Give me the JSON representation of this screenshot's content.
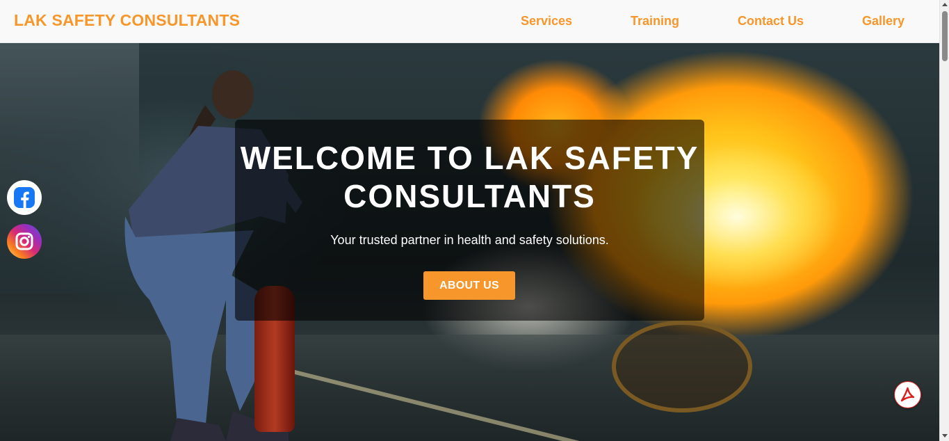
{
  "header": {
    "brand": "LAK SAFETY CONSULTANTS",
    "nav": [
      {
        "label": "Services"
      },
      {
        "label": "Training"
      },
      {
        "label": "Contact Us"
      },
      {
        "label": "Gallery"
      }
    ]
  },
  "hero": {
    "title": "WELCOME TO LAK SAFETY CONSULTANTS",
    "tagline": "Your trusted partner in health and safety solutions.",
    "cta_label": "ABOUT US"
  },
  "social": {
    "facebook_icon": "facebook-icon",
    "instagram_icon": "instagram-icon"
  },
  "floating": {
    "pdf_icon": "pdf-icon"
  },
  "colors": {
    "accent": "#f7962a",
    "overlay": "rgba(0,0,0,0.58)",
    "facebook": "#1877f2",
    "pdf": "#d71e1e"
  }
}
